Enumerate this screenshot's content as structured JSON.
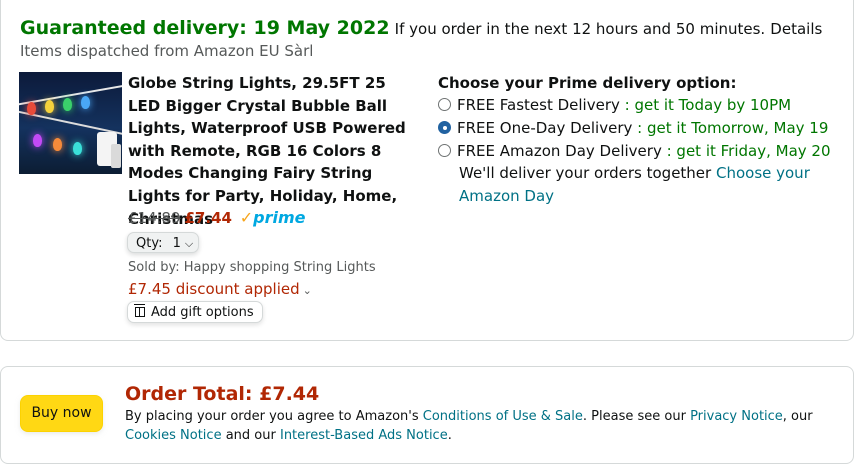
{
  "delivery": {
    "headline": "Guaranteed delivery: 19 May 2022",
    "order_by_text": "If you order in the next 12 hours and 50 minutes.",
    "details_link": "Details",
    "dispatch_text": "Items dispatched from Amazon EU Sàrl"
  },
  "product": {
    "title": "Globe String Lights, 29.5FT 25 LED Bigger Crystal Bubble Ball Lights, Waterproof USB Powered with Remote, RGB 16 Colors 8 Modes Changing Fairy String Lights for Party, Holiday, Home, Christmas",
    "old_price": "£14.89",
    "price": "£7.44",
    "prime_label": "prime",
    "qty_label": "Qty:",
    "qty_value": "1",
    "sold_by": "Sold by:  Happy shopping String Lights",
    "discount": "£7.45 discount applied",
    "gift_label": "Add gift options"
  },
  "prime_options": {
    "heading": "Choose your Prime delivery option:",
    "options": [
      {
        "label": "FREE Fastest Delivery",
        "sep": " : ",
        "when": "get it Today by 10PM",
        "selected": false
      },
      {
        "label": "FREE One-Day Delivery",
        "sep": " : ",
        "when": "get it Tomorrow, May 19",
        "selected": true
      },
      {
        "label": "FREE Amazon Day Delivery",
        "sep": " : ",
        "when": "get it Friday, May 20",
        "selected": false
      }
    ],
    "together_text": "We'll deliver your orders together",
    "choose_day_link": "Choose your Amazon Day"
  },
  "order": {
    "buy_label": "Buy now",
    "total_label": "Order Total:",
    "total_value": "£7.44",
    "legal_1": "By placing your order you agree to Amazon's",
    "conditions_link": "Conditions of Use & Sale",
    "legal_2": ". Please see our",
    "privacy_link": "Privacy Notice",
    "legal_3": ", our",
    "cookies_link": "Cookies Notice",
    "legal_4": "and our",
    "ads_link": "Interest-Based Ads Notice",
    "legal_5": "."
  },
  "colors": {
    "delivery_green": "#007600",
    "price_red": "#b12704",
    "link_teal": "#007185",
    "buy_yellow": "#ffd814",
    "radio_blue": "#2162a1"
  }
}
